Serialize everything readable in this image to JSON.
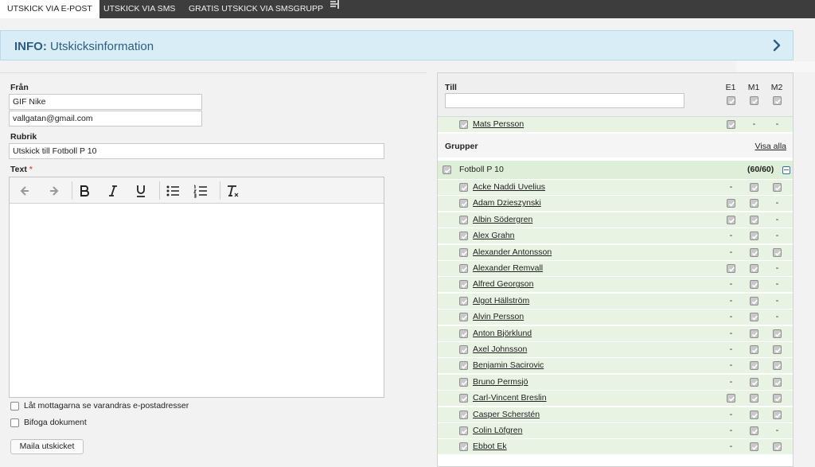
{
  "tabs": [
    {
      "label": "UTSKICK VIA E-POST",
      "active": true
    },
    {
      "label": "UTSKICK VIA SMS",
      "active": false
    },
    {
      "label": "GRATIS UTSKICK VIA SMSGRUPP",
      "active": false,
      "icon": "sms-group-icon"
    }
  ],
  "info": {
    "prefix": "INFO:",
    "title": "Utskicksinformation",
    "icon": "chevron-right-icon"
  },
  "form": {
    "from_label": "Från",
    "from_name": "GIF Nike",
    "from_email": "vallgatan@gmail.com",
    "subject_label": "Rubrik",
    "subject_value": "Utskick till Fotboll P 10",
    "text_label": "Text",
    "required_mark": "*",
    "toolbar": [
      "undo-icon",
      "redo-icon",
      "bold-icon",
      "italic-icon",
      "underline-icon",
      "bullet-list-icon",
      "numbered-list-icon",
      "clear-format-icon"
    ],
    "option_show_addresses": "Låt mottagarna se varandras e-postadresser",
    "option_attach": "Bifoga dokument",
    "send_button": "Maila utskicket"
  },
  "recipients": {
    "till_label": "Till",
    "columns": [
      "E1",
      "M1",
      "M2"
    ],
    "header_checks": [
      true,
      true,
      true
    ],
    "individual": {
      "name": "Mats Persson",
      "e1": true,
      "m1": null,
      "m2": null
    },
    "groups_label": "Grupper",
    "show_all": "Visa alla",
    "group": {
      "name": "Fotboll P 10",
      "count": "(60/60)"
    },
    "members": [
      {
        "name": "Acke Naddi Uvelius",
        "e1": null,
        "m1": true,
        "m2": true
      },
      {
        "name": "Adam Dzieszynski",
        "e1": true,
        "m1": true,
        "m2": null
      },
      {
        "name": "Albin Södergren",
        "e1": true,
        "m1": true,
        "m2": null
      },
      {
        "name": "Alex Grahn",
        "e1": null,
        "m1": true,
        "m2": null
      },
      {
        "name": "Alexander Antonsson",
        "e1": null,
        "m1": true,
        "m2": true
      },
      {
        "name": "Alexander Remvall",
        "e1": true,
        "m1": true,
        "m2": null
      },
      {
        "name": "Alfred Georgson",
        "e1": null,
        "m1": true,
        "m2": null
      },
      {
        "name": "Algot Hällström",
        "e1": null,
        "m1": true,
        "m2": null
      },
      {
        "name": "Alvin Persson",
        "e1": null,
        "m1": true,
        "m2": null
      },
      {
        "name": "Anton Björklund",
        "e1": null,
        "m1": true,
        "m2": true
      },
      {
        "name": "Axel Johnsson",
        "e1": null,
        "m1": true,
        "m2": true
      },
      {
        "name": "Benjamin Sacirovic",
        "e1": null,
        "m1": true,
        "m2": true
      },
      {
        "name": "Bruno Permsjö",
        "e1": null,
        "m1": true,
        "m2": true
      },
      {
        "name": "Carl-Vincent Breslin",
        "e1": true,
        "m1": true,
        "m2": true
      },
      {
        "name": "Casper Scherstén",
        "e1": null,
        "m1": true,
        "m2": true
      },
      {
        "name": "Colin Löfgren",
        "e1": null,
        "m1": true,
        "m2": null
      },
      {
        "name": "Ebbot Ek",
        "e1": null,
        "m1": true,
        "m2": true
      }
    ],
    "dash": "-"
  },
  "colors": {
    "tabbar": "#3d3d3d",
    "info_bg": "#d9edf6",
    "info_text": "#2d5d80",
    "row_bg": "#e9f3e4",
    "checkbox": "#c9c9c9"
  }
}
